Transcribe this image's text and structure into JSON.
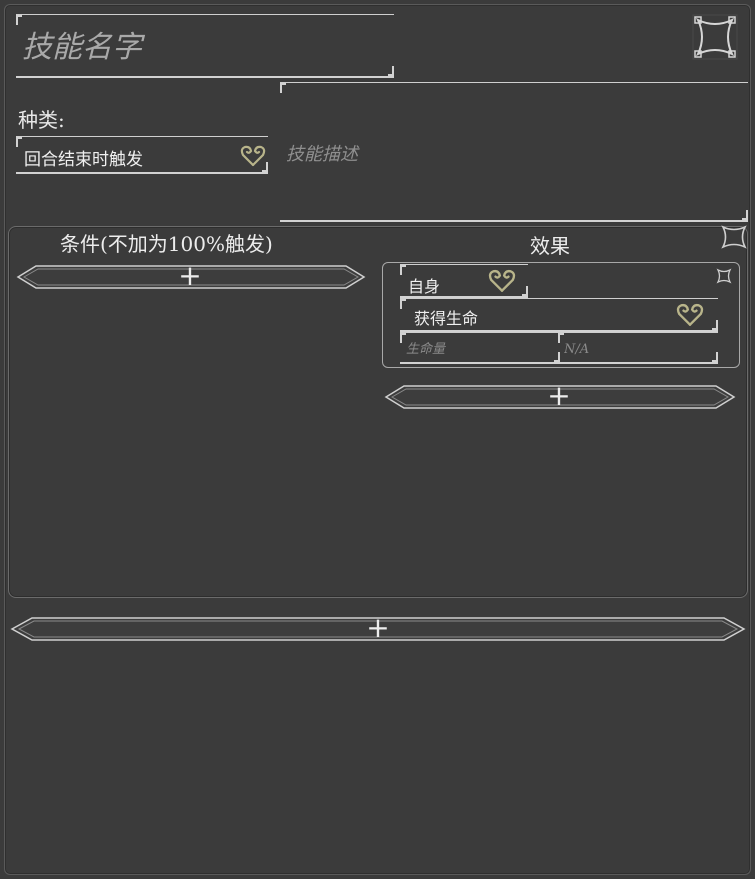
{
  "skill": {
    "name_placeholder": "技能名字",
    "type_label": "种类:",
    "type_value": "回合结束时触发",
    "description_placeholder": "技能描述"
  },
  "conditions": {
    "title": "条件(不加为100%触发)",
    "add_label": "+"
  },
  "effects": {
    "title": "效果",
    "items": [
      {
        "target": "自身",
        "effect_type": "获得生命",
        "amount_placeholder": "生命量",
        "value_placeholder": "N/A"
      }
    ],
    "add_label": "+"
  },
  "bottom": {
    "add_label": "+"
  },
  "icons": {
    "dropdown": "heart-chevron-icon",
    "close": "ornate-close-icon",
    "add": "plus-icon"
  },
  "colors": {
    "background": "#3b3b3b",
    "border": "#d2d2d2",
    "accent_gold": "#b8b48a",
    "text": "#e6e6e6",
    "placeholder": "#9a9a9a"
  }
}
